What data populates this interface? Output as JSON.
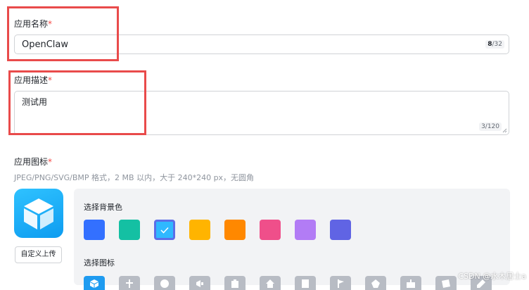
{
  "app_name": {
    "label": "应用名称",
    "required_mark": "*",
    "value": "OpenClaw",
    "count": "8",
    "max": "/32"
  },
  "app_description": {
    "label": "应用描述",
    "required_mark": "*",
    "value": "测试用",
    "counter": "3/120"
  },
  "app_icon": {
    "label": "应用图标",
    "required_mark": "*",
    "hint": "JPEG/PNG/SVG/BMP 格式，2 MB 以内，大于 240*240 px，无圆角",
    "upload_label": "自定义上传",
    "icon_name": "cube-icon"
  },
  "background_picker": {
    "title": "选择背景色",
    "selected_index": 2,
    "colors": [
      "#3370ff",
      "#14c0a3",
      "#2fb8ff",
      "#ffb400",
      "#ff8800",
      "#ef4f8a",
      "#b27cf5",
      "#6064e4"
    ]
  },
  "icon_picker": {
    "title": "选择图标",
    "selected_index": 0,
    "icons": [
      "cube-icon",
      "tools-icon",
      "question-icon",
      "megaphone-icon",
      "clipboard-icon",
      "home-icon",
      "document-icon",
      "flag-icon",
      "gear-icon",
      "gift-icon",
      "chat-icon",
      "pencil-icon"
    ]
  },
  "watermark": "CSDN @水木居士a"
}
